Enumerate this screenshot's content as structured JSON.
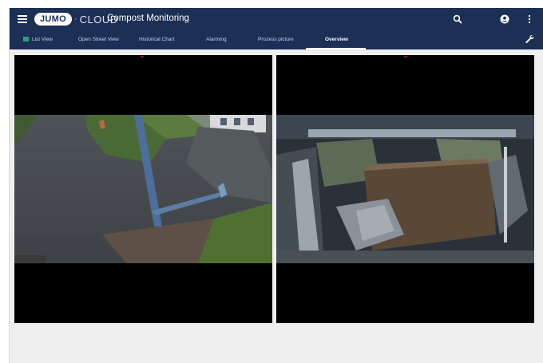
{
  "app": {
    "logo_text": "JUMO",
    "logo_cloud": "CLOUD",
    "title": "Compost Monitoring"
  },
  "toolbar": {
    "icons": [
      "menu-icon",
      "search-icon",
      "account-icon",
      "more-vert-icon"
    ]
  },
  "tabs": [
    {
      "label": "List View",
      "icon": "flag-icon",
      "active": false
    },
    {
      "label": "Open Street View",
      "active": false
    },
    {
      "label": "Historical Chart",
      "active": false
    },
    {
      "label": "Alarming",
      "active": false
    },
    {
      "label": "Prozess picture",
      "active": false
    },
    {
      "label": "Overview",
      "active": true
    }
  ],
  "settings_icon": "wrench-icon",
  "colors": {
    "appbar": "#1c2f54",
    "active_tab": "#ffffff",
    "flag": "#24a87b",
    "background": "#efefef"
  },
  "cameras": [
    {
      "name": "camera-feed-1"
    },
    {
      "name": "camera-feed-2"
    }
  ]
}
